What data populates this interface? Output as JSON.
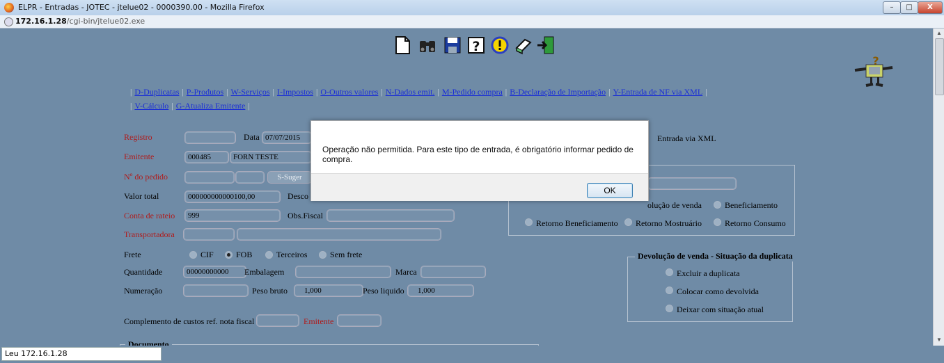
{
  "window": {
    "title": "ELPR - Entradas - JOTEC - jtelue02 - 0000390.00 - Mozilla Firefox",
    "minimize": "–",
    "maximize": "□",
    "close": "X"
  },
  "urlbar": {
    "host": "172.16.1.28",
    "path": "/cgi-bin/jtelue02.exe"
  },
  "status": {
    "text": "Leu 172.16.1.28"
  },
  "toolbar": {
    "icons": [
      "new-document-icon",
      "binoculars-icon",
      "save-disk-icon",
      "help-icon",
      "info-icon",
      "edit-book-icon",
      "exit-door-icon"
    ]
  },
  "menu": {
    "row1": [
      "D-Duplicatas",
      "P-Produtos",
      "W-Serviços",
      "I-Impostos",
      "O-Outros valores",
      "N-Dados emit.",
      "M-Pedido compra",
      "B-Declaração de Importação",
      "Y-Entrada de NF via XML"
    ],
    "row2": [
      "V-Cálculo",
      "G-Atualiza Emitente"
    ]
  },
  "form": {
    "registro_label": "Registro",
    "registro_value": "",
    "data_label": "Data",
    "data_value": "07/07/2015",
    "entrada_xml_label": "Entrada via XML",
    "emitente_label": "Emitente",
    "emitente_code": "000485",
    "emitente_name": "FORN TESTE",
    "pedido_label": "Nº do pedido",
    "sugerir_label": "S-Suger",
    "valor_total_label": "Valor total",
    "valor_total_value": "000000000000100,00",
    "desconto_label": "Desco",
    "conta_rateio_label": "Conta de rateio",
    "conta_rateio_value": "999",
    "obs_fiscal_label": "Obs.Fiscal",
    "transportadora_label": "Transportadora",
    "frete_label": "Frete",
    "frete_options": [
      "CIF",
      "FOB",
      "Terceiros",
      "Sem frete"
    ],
    "frete_selected": "FOB",
    "quantidade_label": "Quantidade",
    "quantidade_value": "00000000000",
    "embalagem_label": "Embalagem",
    "marca_label": "Marca",
    "numeracao_label": "Numeração",
    "peso_bruto_label": "Peso bruto",
    "peso_bruto_value": "1,000",
    "peso_liquido_label": "Peso liquido",
    "peso_liquido_value": "1,000",
    "complemento_label": "Complemento de custos ref. nota fiscal",
    "complemento_emitente_label": "Emitente",
    "documento_legend": "Documento"
  },
  "tipo_entrada": {
    "options_row1": [
      "olução de venda",
      "Beneficiamento"
    ],
    "options_row2": [
      "Retorno Beneficiamento",
      "Retorno Mostruário",
      "Retorno Consumo"
    ]
  },
  "devolucao": {
    "legend": "Devolução de venda - Situação da duplicata",
    "options": [
      "Excluir a duplicata",
      "Colocar como devolvida",
      "Deixar com situação atual"
    ]
  },
  "dialog": {
    "message": "Operação não permitida. Para este tipo de entrada, é obrigatório informar pedido de compra.",
    "ok_label": "OK"
  }
}
